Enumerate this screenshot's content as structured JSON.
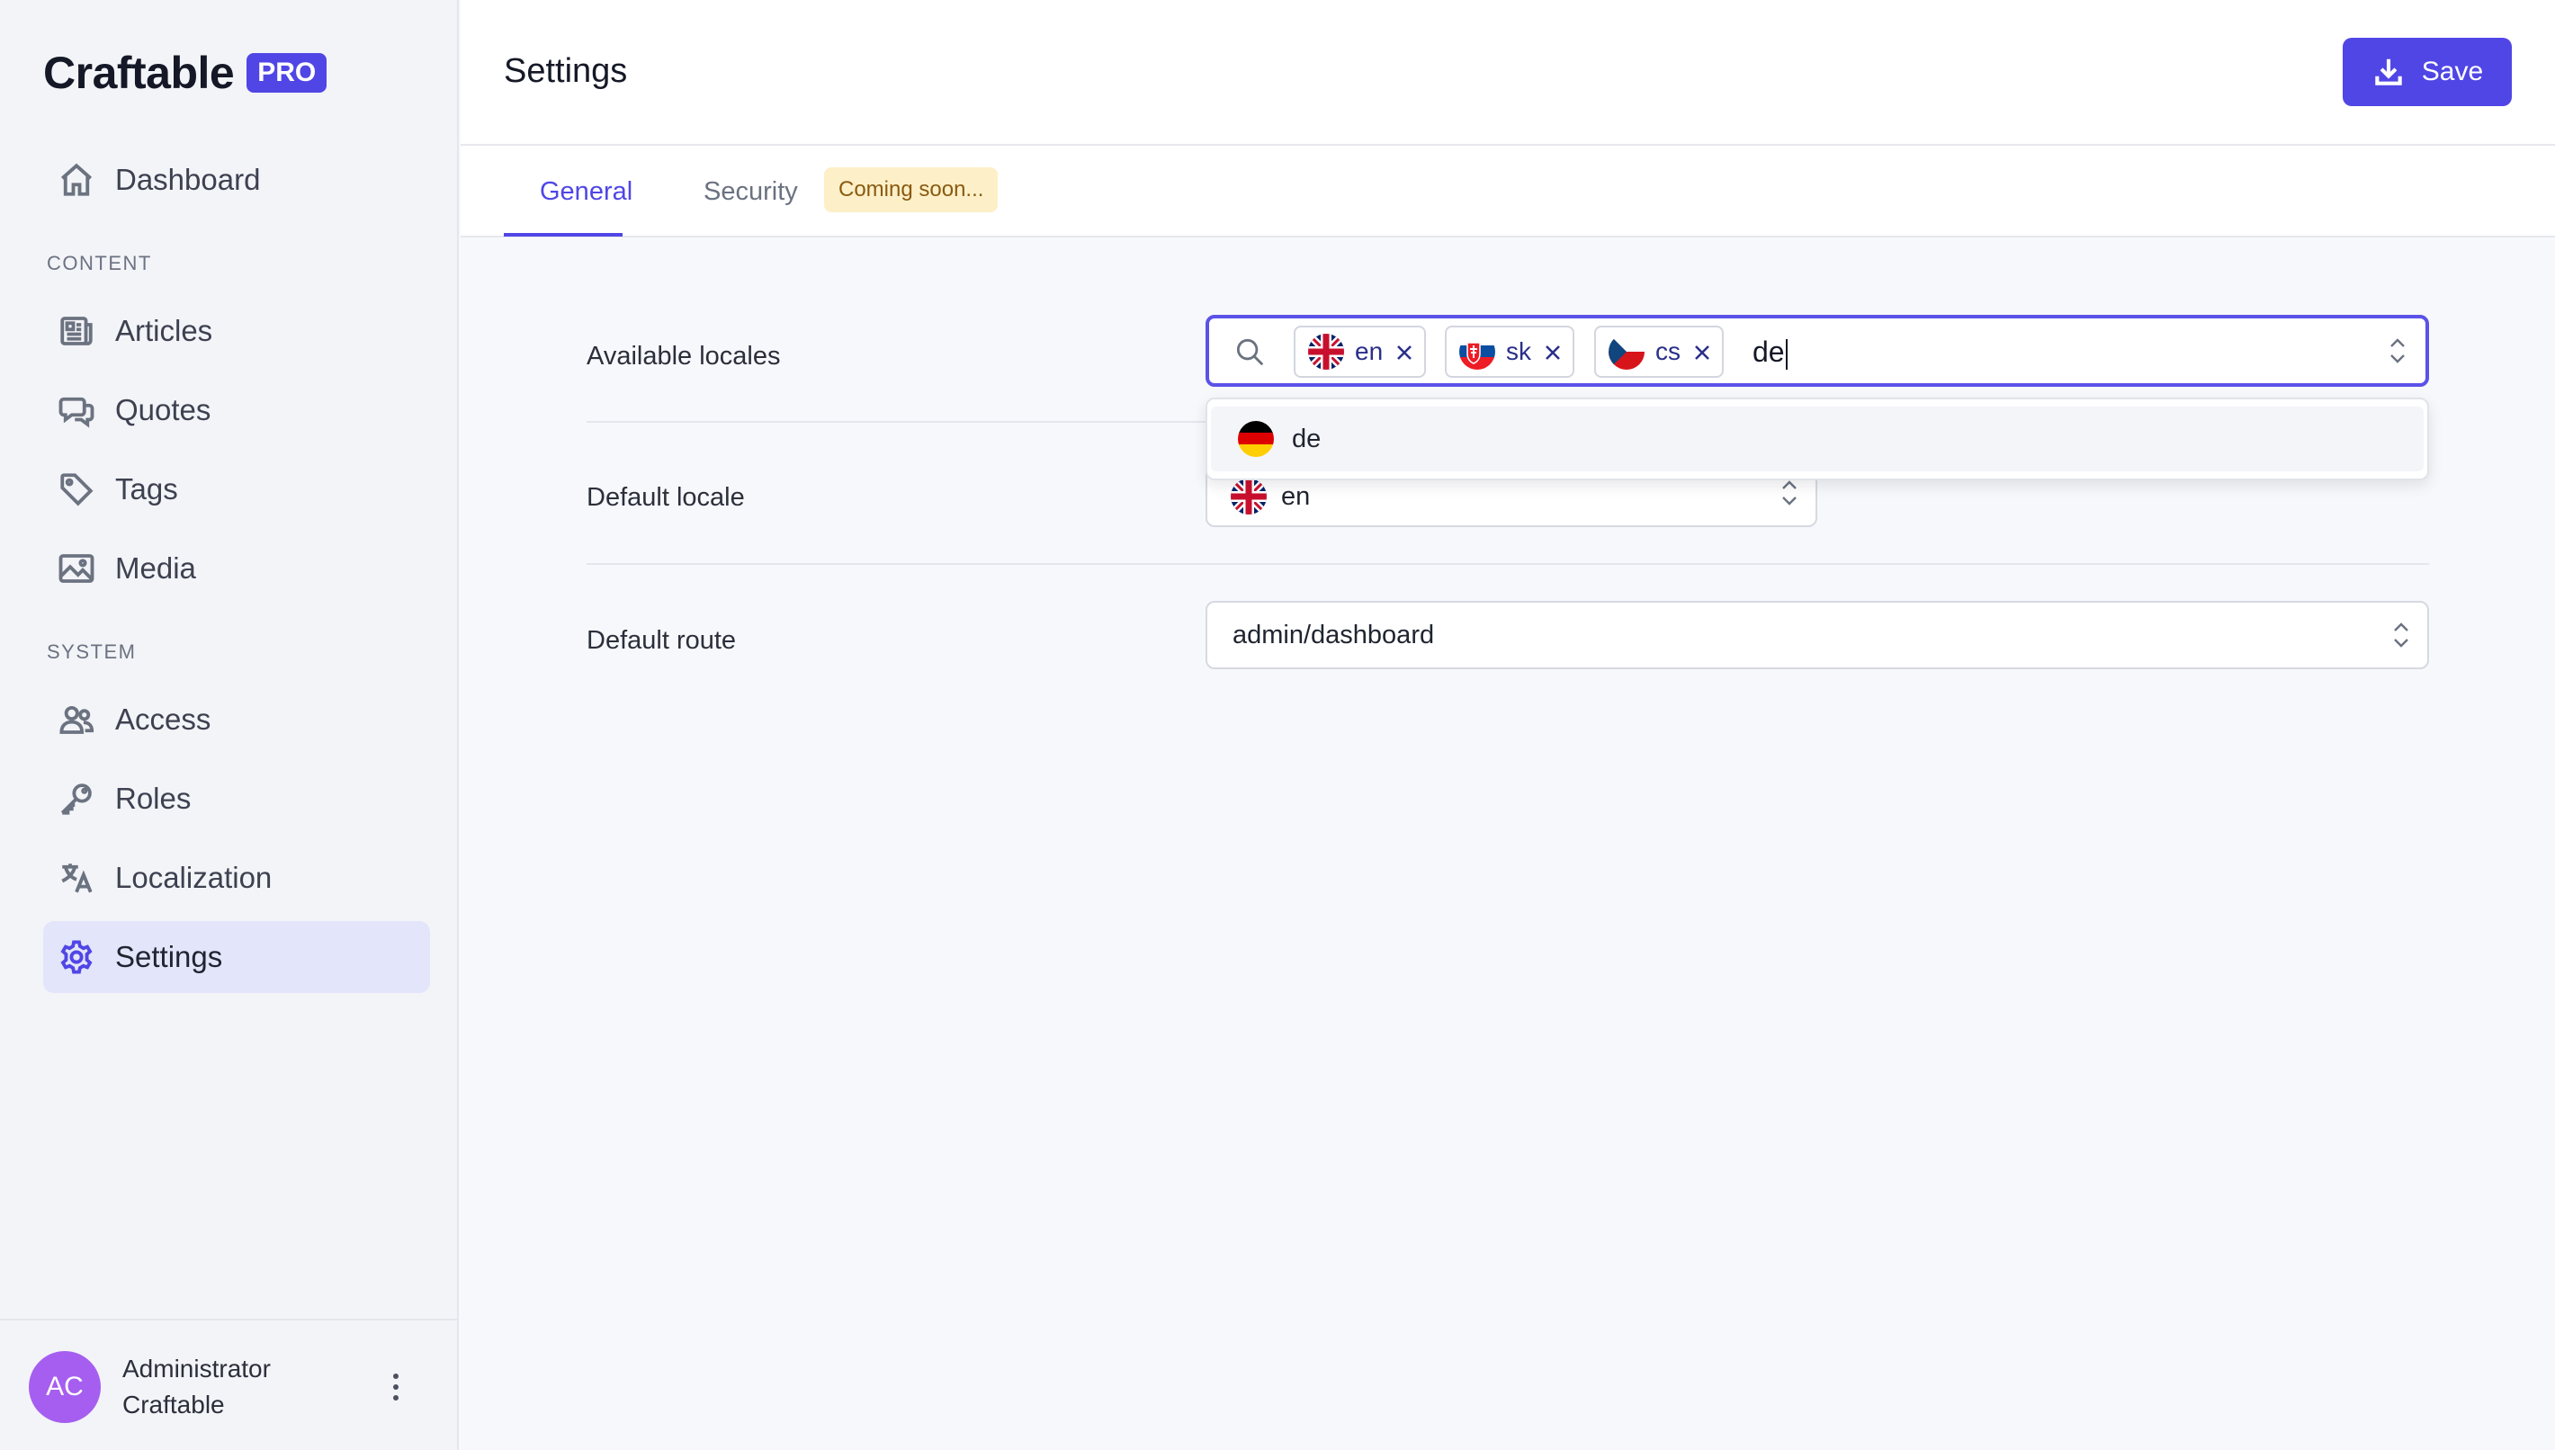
{
  "brand": {
    "name": "Craftable",
    "badge": "PRO"
  },
  "sidebar": {
    "items": [
      {
        "label": "Dashboard",
        "icon": "home-icon"
      },
      {
        "label": "Articles",
        "icon": "newspaper-icon"
      },
      {
        "label": "Quotes",
        "icon": "chat-bubbles-icon"
      },
      {
        "label": "Tags",
        "icon": "tag-icon"
      },
      {
        "label": "Media",
        "icon": "image-icon"
      },
      {
        "label": "Access",
        "icon": "users-icon"
      },
      {
        "label": "Roles",
        "icon": "key-icon"
      },
      {
        "label": "Localization",
        "icon": "translate-icon"
      },
      {
        "label": "Settings",
        "icon": "gear-icon",
        "active": true
      }
    ],
    "sections": {
      "content": "CONTENT",
      "system": "SYSTEM"
    },
    "user": {
      "initials": "AC",
      "first_name": "Administrator",
      "last_name": "Craftable"
    }
  },
  "header": {
    "title": "Settings",
    "save_label": "Save"
  },
  "tabs": [
    {
      "label": "General",
      "active": true
    },
    {
      "label": "Security",
      "badge": "Coming soon..."
    }
  ],
  "form": {
    "available_locales": {
      "label": "Available locales",
      "selected": [
        "en",
        "sk",
        "cs"
      ],
      "search_value": "de",
      "dropdown_options": [
        "de"
      ]
    },
    "default_locale": {
      "label": "Default locale",
      "value": "en"
    },
    "default_route": {
      "label": "Default route",
      "value": "admin/dashboard"
    }
  },
  "colors": {
    "accent": "#5046e5",
    "active_nav_bg": "#e3e5fb",
    "badge_bg": "#fdf0c8"
  }
}
